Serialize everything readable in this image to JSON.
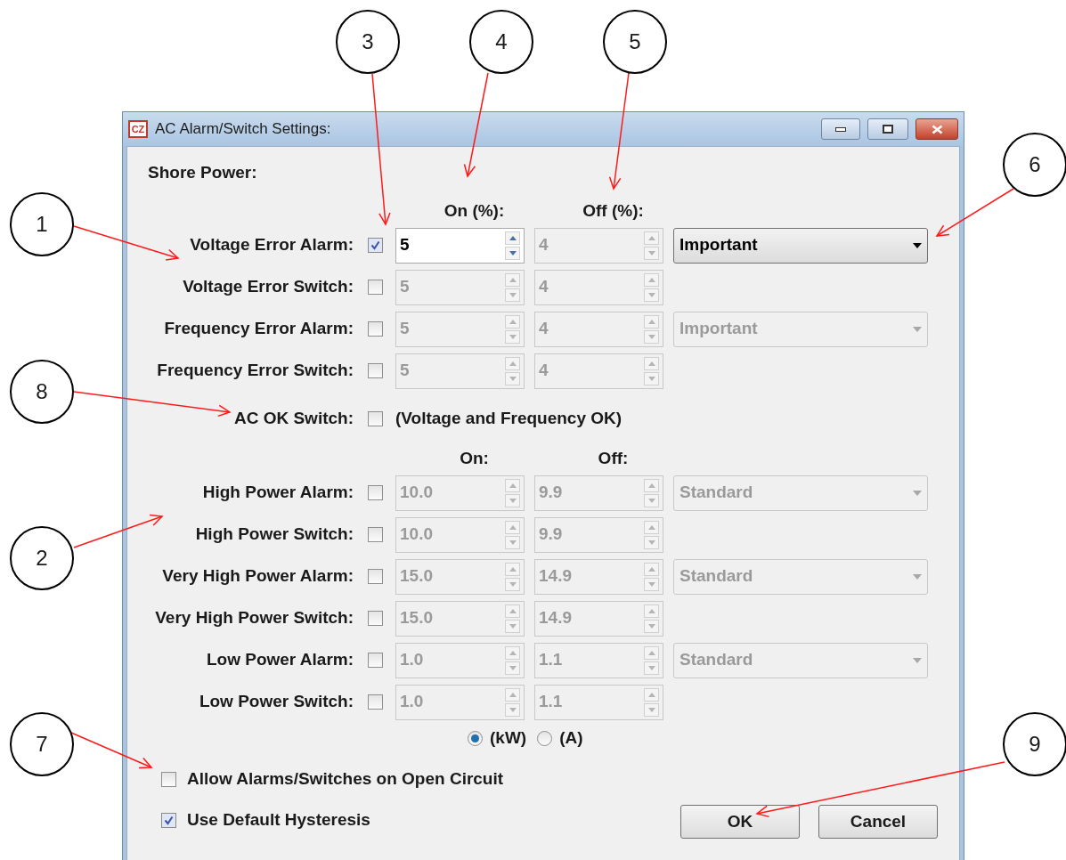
{
  "window": {
    "app_icon": "CZ",
    "title": "AC Alarm/Switch Settings:"
  },
  "shore_power": {
    "title": "Shore Power:",
    "headers": [
      "On (%):",
      "Off (%):"
    ],
    "rows": [
      {
        "label": "Voltage Error Alarm:",
        "checked": true,
        "on": {
          "value": "5",
          "disabled": false
        },
        "off": {
          "value": "4",
          "disabled": true
        },
        "priority": {
          "value": "Important",
          "disabled": false
        }
      },
      {
        "label": "Voltage Error Switch:",
        "checked": false,
        "on": {
          "value": "5",
          "disabled": true
        },
        "off": {
          "value": "4",
          "disabled": true
        }
      },
      {
        "label": "Frequency Error Alarm:",
        "checked": false,
        "on": {
          "value": "5",
          "disabled": true
        },
        "off": {
          "value": "4",
          "disabled": true
        },
        "priority": {
          "value": "Important",
          "disabled": true
        }
      },
      {
        "label": "Frequency Error Switch:",
        "checked": false,
        "on": {
          "value": "5",
          "disabled": true
        },
        "off": {
          "value": "4",
          "disabled": true
        }
      }
    ],
    "ac_ok": {
      "label": "AC OK Switch:",
      "checked": false,
      "note": "(Voltage and Frequency OK)"
    }
  },
  "power": {
    "headers": [
      "On:",
      "Off:"
    ],
    "rows": [
      {
        "label": "High Power Alarm:",
        "checked": false,
        "on": {
          "value": "10.0",
          "disabled": true
        },
        "off": {
          "value": "9.9",
          "disabled": true
        },
        "priority": {
          "value": "Standard",
          "disabled": true
        }
      },
      {
        "label": "High Power Switch:",
        "checked": false,
        "on": {
          "value": "10.0",
          "disabled": true
        },
        "off": {
          "value": "9.9",
          "disabled": true
        }
      },
      {
        "label": "Very High Power Alarm:",
        "checked": false,
        "on": {
          "value": "15.0",
          "disabled": true
        },
        "off": {
          "value": "14.9",
          "disabled": true
        },
        "priority": {
          "value": "Standard",
          "disabled": true
        }
      },
      {
        "label": "Very High Power Switch:",
        "checked": false,
        "on": {
          "value": "15.0",
          "disabled": true
        },
        "off": {
          "value": "14.9",
          "disabled": true
        }
      },
      {
        "label": "Low Power Alarm:",
        "checked": false,
        "on": {
          "value": "1.0",
          "disabled": true
        },
        "off": {
          "value": "1.1",
          "disabled": true
        },
        "priority": {
          "value": "Standard",
          "disabled": true
        }
      },
      {
        "label": "Low Power Switch:",
        "checked": false,
        "on": {
          "value": "1.0",
          "disabled": true
        },
        "off": {
          "value": "1.1",
          "disabled": true
        }
      }
    ],
    "units": [
      {
        "label": "(kW)",
        "selected": true
      },
      {
        "label": "(A)",
        "selected": false
      }
    ]
  },
  "options": [
    {
      "label": "Allow Alarms/Switches on Open Circuit",
      "checked": false
    },
    {
      "label": "Use Default Hysteresis",
      "checked": true
    }
  ],
  "buttons": [
    "OK",
    "Cancel"
  ],
  "callouts": [
    "3",
    "4",
    "5",
    "6",
    "1",
    "8",
    "2",
    "7",
    "9"
  ]
}
